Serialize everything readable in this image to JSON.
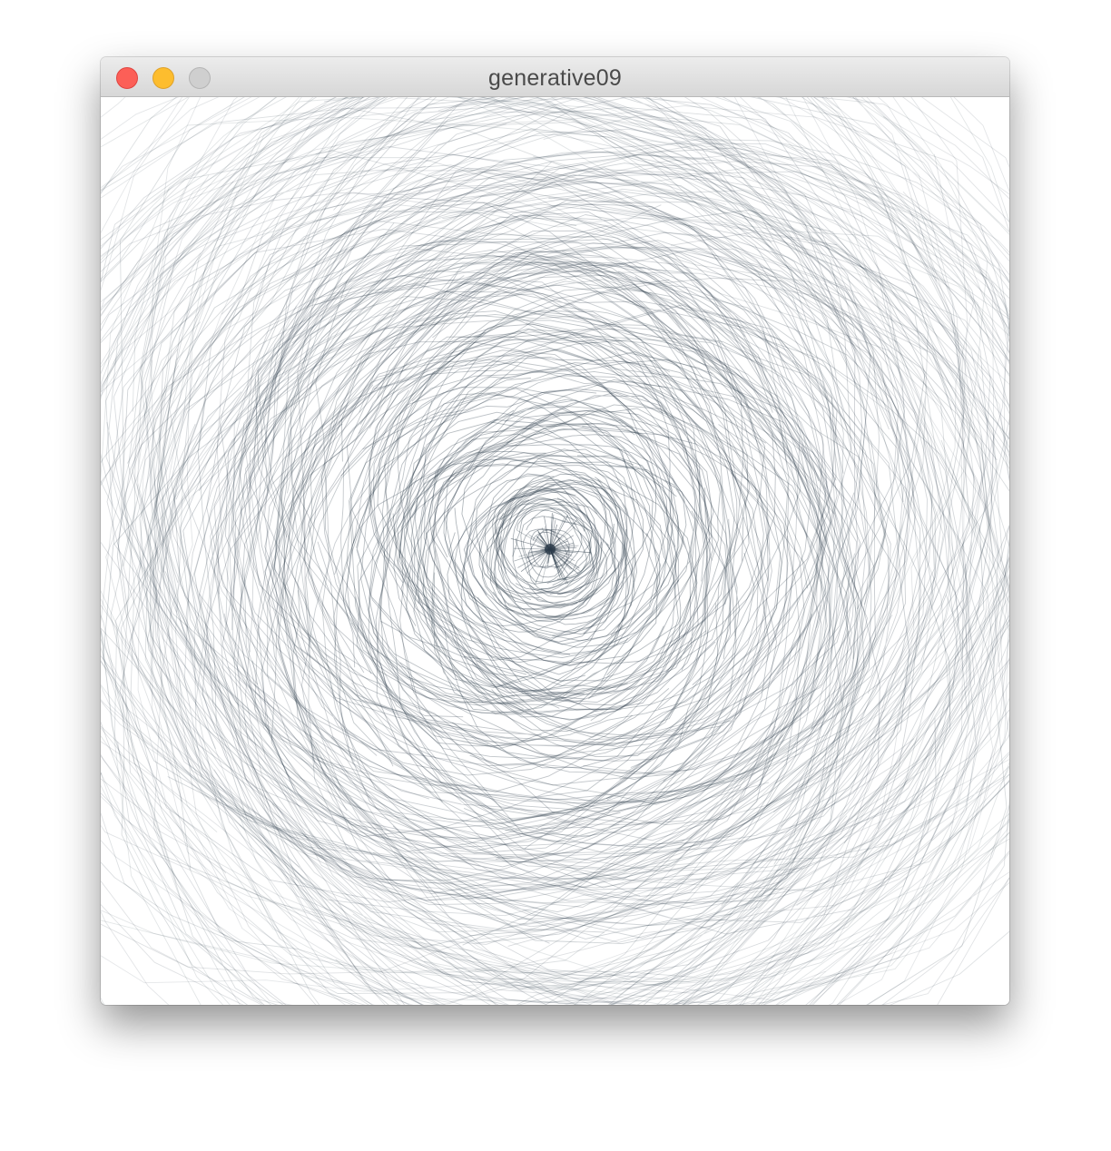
{
  "window": {
    "title": "generative09",
    "controls": {
      "close": {
        "icon": "close-icon",
        "color": "#fc5f57"
      },
      "minimize": {
        "icon": "minimize-icon",
        "color": "#fdbd2e"
      },
      "zoom": {
        "icon": "zoom-icon",
        "color": "#cfcfcf"
      }
    }
  },
  "artwork": {
    "background": "#ffffff",
    "stroke_color": "#2a3a48"
  }
}
